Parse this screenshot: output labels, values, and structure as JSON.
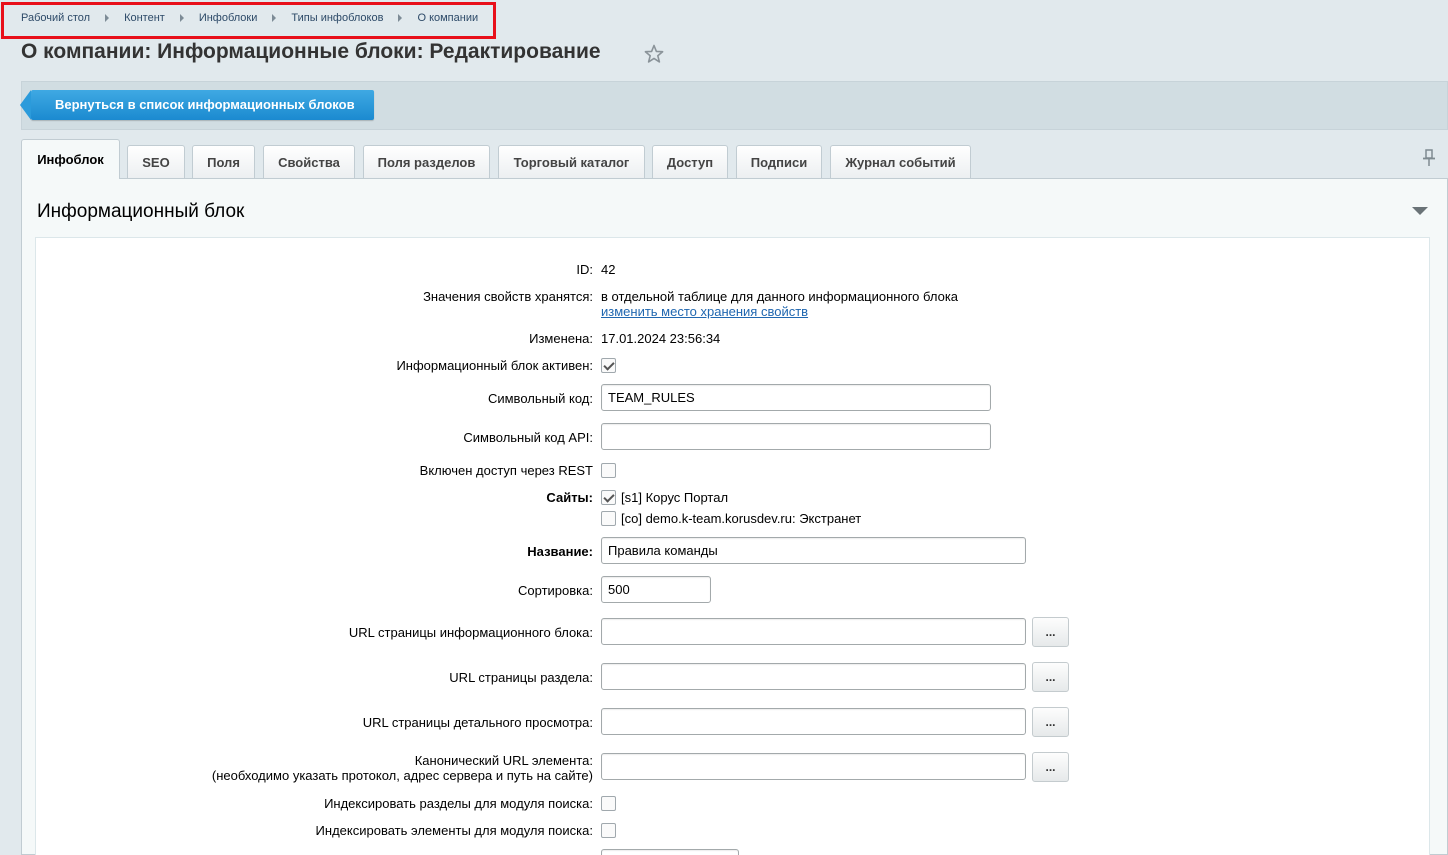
{
  "breadcrumb": [
    "Рабочий стол",
    "Контент",
    "Инфоблоки",
    "Типы инфоблоков",
    "О компании"
  ],
  "page_title": "О компании: Информационные блоки: Редактирование",
  "toolbar": {
    "back_label": "Вернуться в список информационных блоков"
  },
  "tabs": [
    "Инфоблок",
    "SEO",
    "Поля",
    "Свойства",
    "Поля разделов",
    "Торговый каталог",
    "Доступ",
    "Подписи",
    "Журнал событий"
  ],
  "section_title": "Информационный блок",
  "form": {
    "id_label": "ID:",
    "id_value": "42",
    "storage_label": "Значения свойств хранятся:",
    "storage_value": "в отдельной таблице для данного информационного блока",
    "storage_link": "изменить место хранения свойств",
    "modified_label": "Изменена:",
    "modified_value": "17.01.2024 23:56:34",
    "active_label": "Информационный блок активен:",
    "active_checked": true,
    "code_label": "Символьный код:",
    "code_value": "TEAM_RULES",
    "api_code_label": "Символьный код API:",
    "api_code_value": "",
    "rest_label": "Включен доступ через REST",
    "rest_checked": false,
    "sites_label": "Сайты:",
    "site1_label": "[s1] Корус Портал",
    "site1_checked": true,
    "site2_label": "[co] demo.k-team.korusdev.ru: Экстранет",
    "site2_checked": false,
    "name_label": "Название:",
    "name_value": "Правила команды",
    "sort_label": "Сортировка:",
    "sort_value": "500",
    "url_iblock_label": "URL страницы информационного блока:",
    "url_section_label": "URL страницы раздела:",
    "url_detail_label": "URL страницы детального просмотра:",
    "canonical_label": "Канонический URL элемента:",
    "canonical_hint": "(необходимо указать протокол, адрес сервера и путь на сайте)",
    "dots_label": "...",
    "index_sections_label": "Индексировать разделы для модуля поиска:",
    "index_elements_label": "Индексировать элементы для модуля поиска:"
  }
}
